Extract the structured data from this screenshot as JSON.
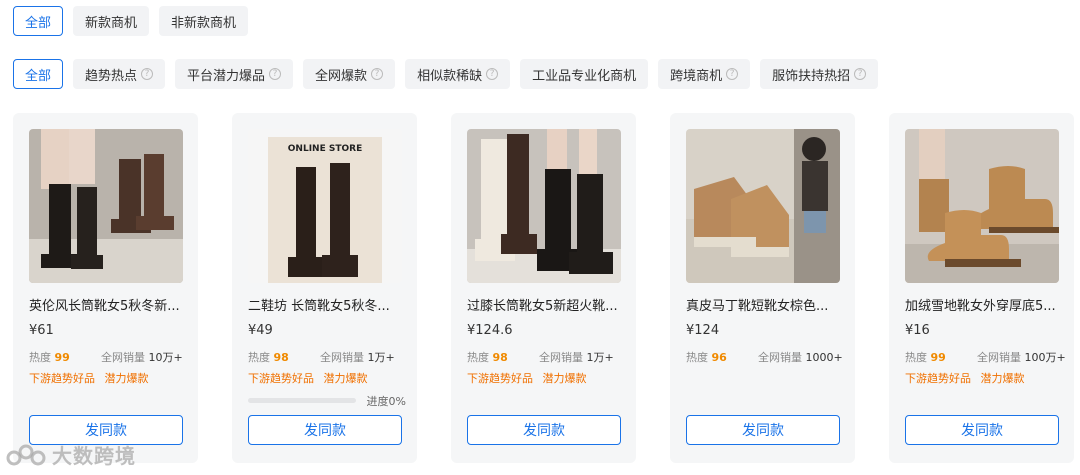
{
  "filters_row1": [
    {
      "label": "全部",
      "active": true
    },
    {
      "label": "新款商机",
      "active": false
    },
    {
      "label": "非新款商机",
      "active": false
    }
  ],
  "filters_row2": [
    {
      "label": "全部",
      "active": true,
      "help": false
    },
    {
      "label": "趋势热点",
      "active": false,
      "help": true
    },
    {
      "label": "平台潜力爆品",
      "active": false,
      "help": true
    },
    {
      "label": "全网爆款",
      "active": false,
      "help": true
    },
    {
      "label": "相似款稀缺",
      "active": false,
      "help": true
    },
    {
      "label": "工业品专业化商机",
      "active": false,
      "help": false
    },
    {
      "label": "跨境商机",
      "active": false,
      "help": true
    },
    {
      "label": "服饰扶持热招",
      "active": false,
      "help": true
    }
  ],
  "help_glyph": "?",
  "labels": {
    "heat": "热度",
    "sales": "全网销量",
    "button": "发同款"
  },
  "products": [
    {
      "title": "英伦风长筒靴女5秋冬新...",
      "price": "¥61",
      "heat": "99",
      "sales": "10万+",
      "tags": [
        "下游趋势好品",
        "潜力爆款"
      ],
      "progress_text": ""
    },
    {
      "title": "二鞋坊 长筒靴女5秋冬...",
      "price": "¥49",
      "heat": "98",
      "sales": "1万+",
      "tags": [
        "下游趋势好品",
        "潜力爆款"
      ],
      "progress_text": "进度0%",
      "progress": 0
    },
    {
      "title": "过膝长筒靴女5新超火靴...",
      "price": "¥124.6",
      "heat": "98",
      "sales": "1万+",
      "tags": [
        "下游趋势好品",
        "潜力爆款"
      ],
      "progress_text": ""
    },
    {
      "title": "真皮马丁靴短靴女棕色...",
      "price": "¥124",
      "heat": "96",
      "sales": "1000+",
      "tags": [],
      "progress_text": ""
    },
    {
      "title": "加绒雪地靴女外穿厚底5...",
      "price": "¥16",
      "heat": "99",
      "sales": "100万+",
      "tags": [
        "下游趋势好品",
        "潜力爆款"
      ],
      "progress_text": ""
    }
  ],
  "image_text": {
    "store": "ONLINE STORE"
  },
  "watermark": "大数跨境",
  "colors": {
    "accent": "#1a73e8",
    "heat": "#f08a00",
    "tag": "#f07000"
  }
}
